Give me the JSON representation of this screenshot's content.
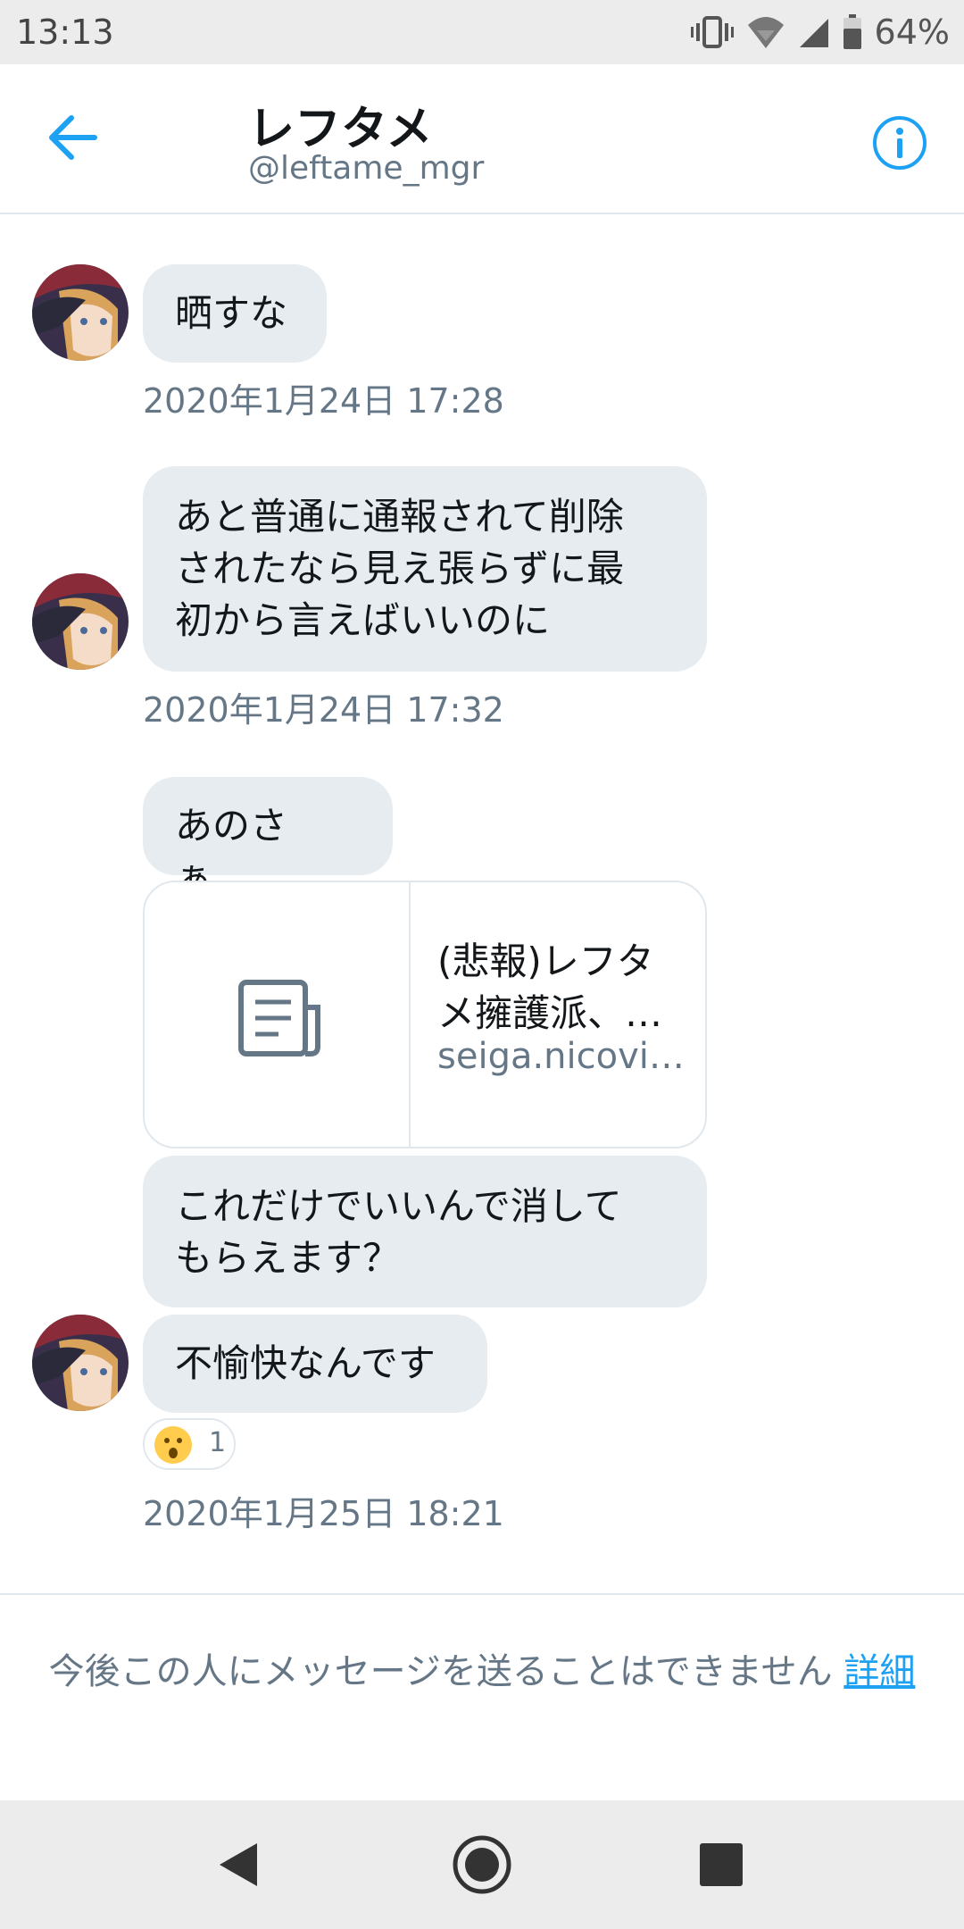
{
  "status_bar": {
    "time": "13:13",
    "battery_percent": "64%",
    "icons": [
      "vibrate-icon",
      "wifi-icon",
      "signal-icon",
      "battery-icon"
    ]
  },
  "header": {
    "name": "レフタメ",
    "handle": "@leftame_mgr",
    "back_icon": "arrow-left-icon",
    "info_icon": "info-circle-icon"
  },
  "messages": [
    {
      "text": "晒すな"
    },
    {
      "line1": "あと普通に通報されて削除",
      "line2": "されたなら見え張らずに最",
      "line3": "初から言えばいいのに"
    },
    {
      "text": "あのさぁ…"
    },
    {
      "line1": "これだけでいいんで消して",
      "line2": "もらえます？"
    },
    {
      "text": "不愉快なんです"
    }
  ],
  "timestamps": [
    "2020年1月24日 17:28",
    "2020年1月24日 17:32",
    "2020年1月25日 18:21"
  ],
  "link_card": {
    "title_line1": "(悲報)レフタ",
    "title_line2": "メ擁護派、…",
    "domain": "seiga.nicovi…",
    "icon": "document-icon"
  },
  "reaction": {
    "emoji": "surprised-face-emoji",
    "count": "1"
  },
  "notice": {
    "text": "今後この人にメッセージを送ることはできません",
    "link": "詳細"
  },
  "nav_bar": {
    "icons": [
      "back-triangle-icon",
      "home-circle-icon",
      "recents-square-icon"
    ]
  },
  "colors": {
    "accent": "#1da1f2",
    "bubble": "#e6ecf0",
    "secondary_text": "#657786"
  }
}
